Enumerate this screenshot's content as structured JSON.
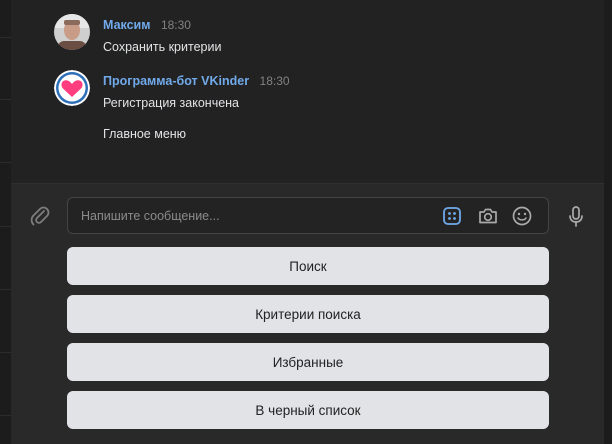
{
  "messages": [
    {
      "sender": "Максим",
      "time": "18:30",
      "lines": [
        "Сохранить критерии"
      ],
      "avatar_icon": "user-photo-avatar"
    },
    {
      "sender": "Программа-бот VKinder",
      "time": "18:30",
      "lines": [
        "Регистрация закончена",
        "Главное меню"
      ],
      "avatar_icon": "heart-avatar"
    }
  ],
  "composer": {
    "placeholder": "Напишите сообщение...",
    "icons": [
      "paperclip-icon",
      "bot-keyboard-icon",
      "camera-icon",
      "emoji-icon",
      "microphone-icon"
    ]
  },
  "keyboard": {
    "buttons": [
      "Поиск",
      "Критерии поиска",
      "Избранные",
      "В черный список"
    ]
  },
  "colors": {
    "accent": "#71aaeb",
    "background": "#222222",
    "button": "#e1e3e6",
    "heart": "#ff3d7f"
  }
}
